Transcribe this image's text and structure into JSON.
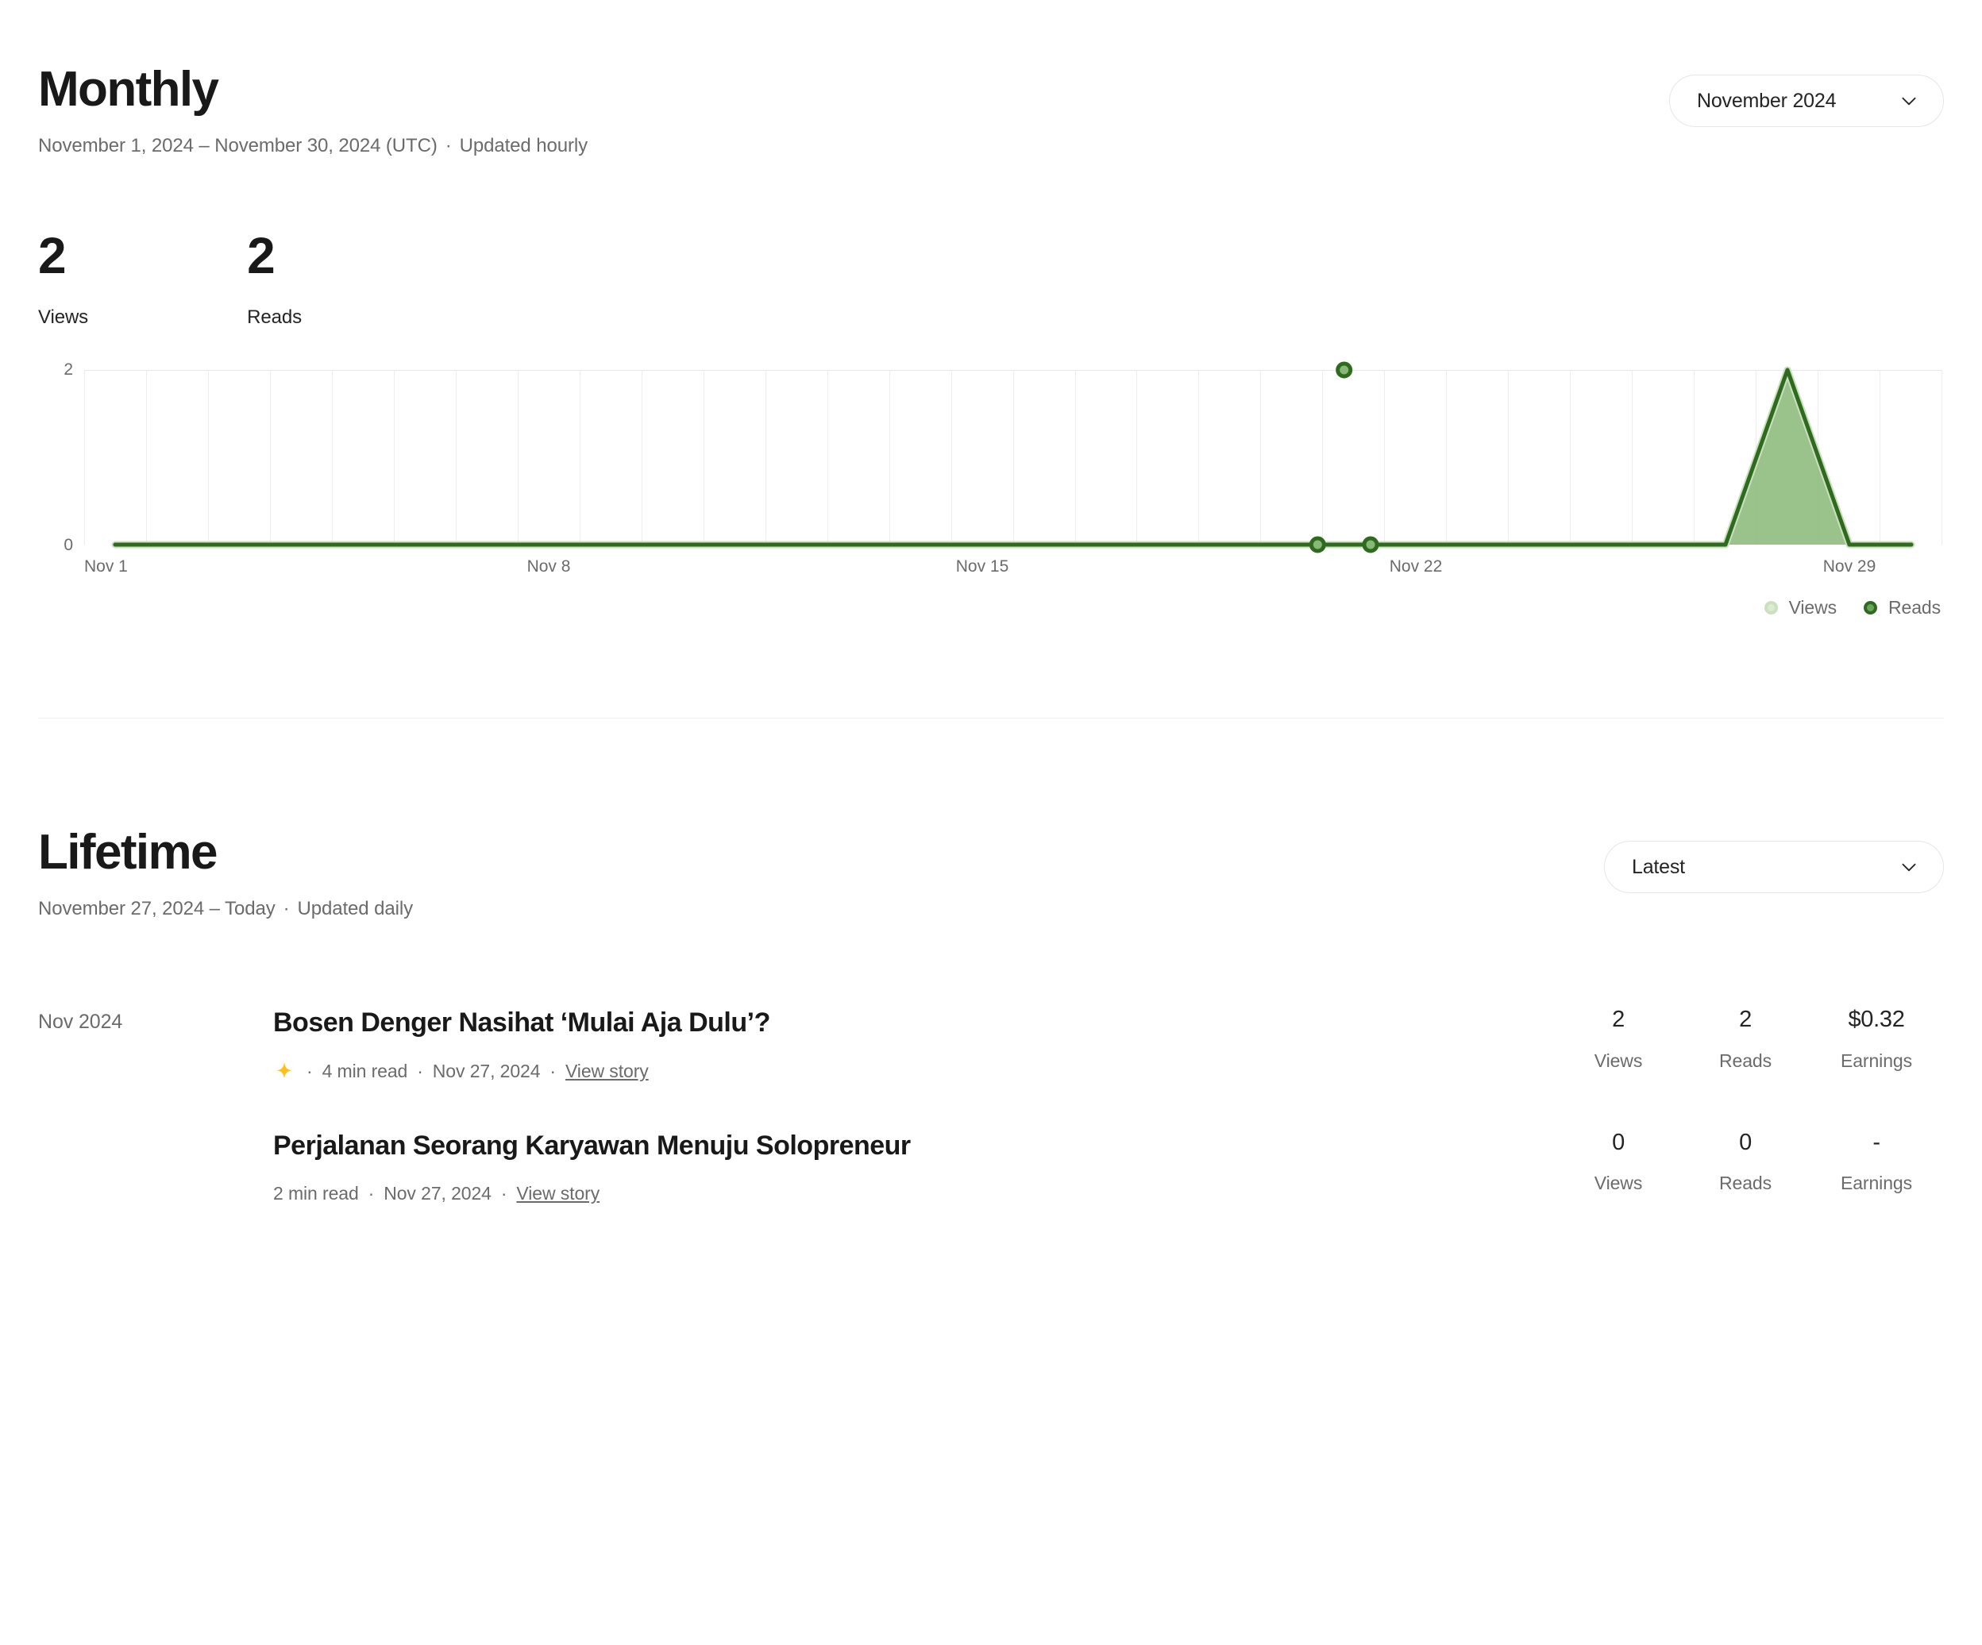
{
  "monthly": {
    "title": "Monthly",
    "subtitle_range": "November 1, 2024 – November 30, 2024 (UTC)",
    "subtitle_sep": "·",
    "subtitle_updated": "Updated hourly",
    "period_selector": {
      "label": "November 2024",
      "icon": "chevron-down-icon"
    },
    "stats": [
      {
        "value": "2",
        "label": "Views"
      },
      {
        "value": "2",
        "label": "Reads"
      }
    ]
  },
  "chart_data": {
    "type": "line",
    "title": "",
    "xlabel": "",
    "ylabel": "",
    "ylim": [
      0,
      2
    ],
    "ytick_labels": [
      "0",
      "2"
    ],
    "grid": true,
    "legend_position": "bottom-right",
    "x_tick_labels": [
      "Nov 1",
      "Nov 8",
      "Nov 15",
      "Nov 22",
      "Nov 29"
    ],
    "x_tick_days": [
      1,
      8,
      15,
      22,
      29
    ],
    "categories": [
      "Nov 1",
      "Nov 2",
      "Nov 3",
      "Nov 4",
      "Nov 5",
      "Nov 6",
      "Nov 7",
      "Nov 8",
      "Nov 9",
      "Nov 10",
      "Nov 11",
      "Nov 12",
      "Nov 13",
      "Nov 14",
      "Nov 15",
      "Nov 16",
      "Nov 17",
      "Nov 18",
      "Nov 19",
      "Nov 20",
      "Nov 21",
      "Nov 22",
      "Nov 23",
      "Nov 24",
      "Nov 25",
      "Nov 26",
      "Nov 27",
      "Nov 28",
      "Nov 29",
      "Nov 30"
    ],
    "series": [
      {
        "name": "Views",
        "color": "#CBE0BE",
        "values": [
          0,
          0,
          0,
          0,
          0,
          0,
          0,
          0,
          0,
          0,
          0,
          0,
          0,
          0,
          0,
          0,
          0,
          0,
          0,
          0,
          0,
          0,
          0,
          0,
          0,
          0,
          0,
          2,
          0,
          0
        ]
      },
      {
        "name": "Reads",
        "color": "#2E6B1F",
        "fill": "#88B877",
        "values": [
          0,
          0,
          0,
          0,
          0,
          0,
          0,
          0,
          0,
          0,
          0,
          0,
          0,
          0,
          0,
          0,
          0,
          0,
          0,
          0,
          0,
          0,
          0,
          0,
          0,
          0,
          0,
          2,
          0,
          0
        ]
      }
    ],
    "markers": [
      {
        "x_day": 27,
        "value": 0
      },
      {
        "x_day": 28,
        "value": 2
      },
      {
        "x_day": 29,
        "value": 0
      }
    ],
    "legend": [
      {
        "label": "Views",
        "swatch": "views"
      },
      {
        "label": "Reads",
        "swatch": "reads"
      }
    ]
  },
  "lifetime": {
    "title": "Lifetime",
    "subtitle_range": "November 27, 2024 – Today",
    "subtitle_sep": "·",
    "subtitle_updated": "Updated daily",
    "sort_selector": {
      "label": "Latest",
      "icon": "chevron-down-icon"
    },
    "stat_labels": {
      "views": "Views",
      "reads": "Reads",
      "earnings": "Earnings"
    },
    "meta_sep": "·",
    "view_story_label": "View story",
    "stories": [
      {
        "date_group": "Nov 2024",
        "title": "Bosen Denger Nasihat ‘Mulai Aja Dulu’?",
        "member_only": true,
        "read_time": "4 min read",
        "published": "Nov 27, 2024",
        "views": "2",
        "reads": "2",
        "earnings": "$0.32"
      },
      {
        "date_group": "",
        "title": "Perjalanan Seorang Karyawan Menuju Solopreneur",
        "member_only": false,
        "read_time": "2 min read",
        "published": "Nov 27, 2024",
        "views": "0",
        "reads": "0",
        "earnings": "-"
      }
    ]
  }
}
